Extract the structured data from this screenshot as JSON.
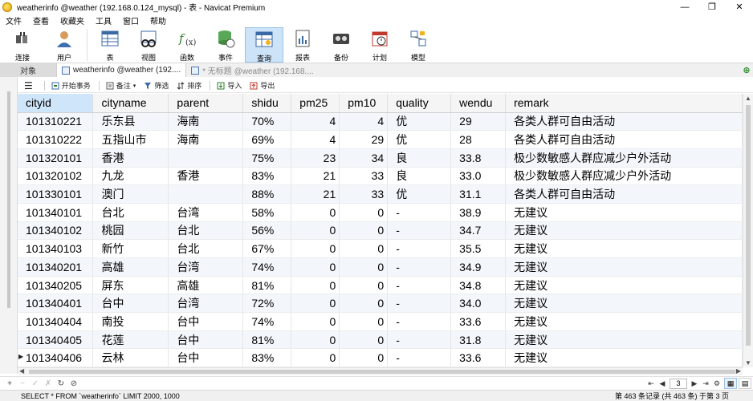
{
  "window": {
    "title": "weatherinfo @weather (192.168.0.124_mysql) - 表 - Navicat Premium",
    "minimize": "—",
    "restore": "❐",
    "close": "✕"
  },
  "menu": [
    "文件",
    "查看",
    "收藏夹",
    "工具",
    "窗口",
    "帮助"
  ],
  "ribbon": [
    {
      "label": "连接",
      "icon": "connection-icon"
    },
    {
      "label": "用户",
      "icon": "user-icon"
    },
    {
      "label": "表",
      "icon": "table-icon"
    },
    {
      "label": "视图",
      "icon": "view-icon"
    },
    {
      "label": "函数",
      "icon": "function-icon"
    },
    {
      "label": "事件",
      "icon": "event-icon"
    },
    {
      "label": "查询",
      "icon": "query-icon",
      "active": true
    },
    {
      "label": "报表",
      "icon": "report-icon"
    },
    {
      "label": "备份",
      "icon": "backup-icon"
    },
    {
      "label": "计划",
      "icon": "schedule-icon"
    },
    {
      "label": "模型",
      "icon": "model-icon"
    }
  ],
  "tabs": {
    "objects": "对象",
    "active": "weatherinfo @weather (192....",
    "untitled": "* 无标题 @weather (192.168...."
  },
  "subtoolbar": {
    "menu": "☰",
    "begin_transaction": "开始事务",
    "memo": "备注",
    "filter": "筛选",
    "sort": "排序",
    "import": "导入",
    "export": "导出"
  },
  "grid": {
    "columns": [
      "cityid",
      "cityname",
      "parent",
      "shidu",
      "pm25",
      "pm10",
      "quality",
      "wendu",
      "remark"
    ],
    "rows": [
      [
        "101310221",
        "乐东县",
        "海南",
        "70%",
        "4",
        "4",
        "优",
        "29",
        "各类人群可自由活动"
      ],
      [
        "101310222",
        "五指山市",
        "海南",
        "69%",
        "4",
        "29",
        "优",
        "28",
        "各类人群可自由活动"
      ],
      [
        "101320101",
        "香港",
        "",
        "75%",
        "23",
        "34",
        "良",
        "33.8",
        "极少数敏感人群应减少户外活动"
      ],
      [
        "101320102",
        "九龙",
        "香港",
        "83%",
        "21",
        "33",
        "良",
        "33.0",
        "极少数敏感人群应减少户外活动"
      ],
      [
        "101330101",
        "澳门",
        "",
        "88%",
        "21",
        "33",
        "优",
        "31.1",
        "各类人群可自由活动"
      ],
      [
        "101340101",
        "台北",
        "台湾",
        "58%",
        "0",
        "0",
        "-",
        "38.9",
        "无建议"
      ],
      [
        "101340102",
        "桃园",
        "台北",
        "56%",
        "0",
        "0",
        "-",
        "34.7",
        "无建议"
      ],
      [
        "101340103",
        "新竹",
        "台北",
        "67%",
        "0",
        "0",
        "-",
        "35.5",
        "无建议"
      ],
      [
        "101340201",
        "高雄",
        "台湾",
        "74%",
        "0",
        "0",
        "-",
        "34.9",
        "无建议"
      ],
      [
        "101340205",
        "屏东",
        "高雄",
        "81%",
        "0",
        "0",
        "-",
        "34.8",
        "无建议"
      ],
      [
        "101340401",
        "台中",
        "台湾",
        "72%",
        "0",
        "0",
        "-",
        "34.0",
        "无建议"
      ],
      [
        "101340404",
        "南投",
        "台中",
        "74%",
        "0",
        "0",
        "-",
        "33.6",
        "无建议"
      ],
      [
        "101340405",
        "花莲",
        "台中",
        "81%",
        "0",
        "0",
        "-",
        "31.8",
        "无建议"
      ],
      [
        "101340406",
        "云林",
        "台中",
        "83%",
        "0",
        "0",
        "-",
        "33.6",
        "无建议"
      ]
    ],
    "current_row": 13
  },
  "navbar": {
    "add": "+",
    "delete": "−",
    "apply": "✓",
    "discard": "✗",
    "refresh": "↻",
    "stop": "⊘",
    "first": "⇤",
    "prev": "◀",
    "page": "3",
    "next": "▶",
    "last": "⇥",
    "settings": "⚙"
  },
  "status": {
    "sql": "SELECT * FROM `weatherinfo` LIMIT 2000, 1000",
    "records": "第 463 条记录 (共 463 条) 于第 3 页"
  }
}
